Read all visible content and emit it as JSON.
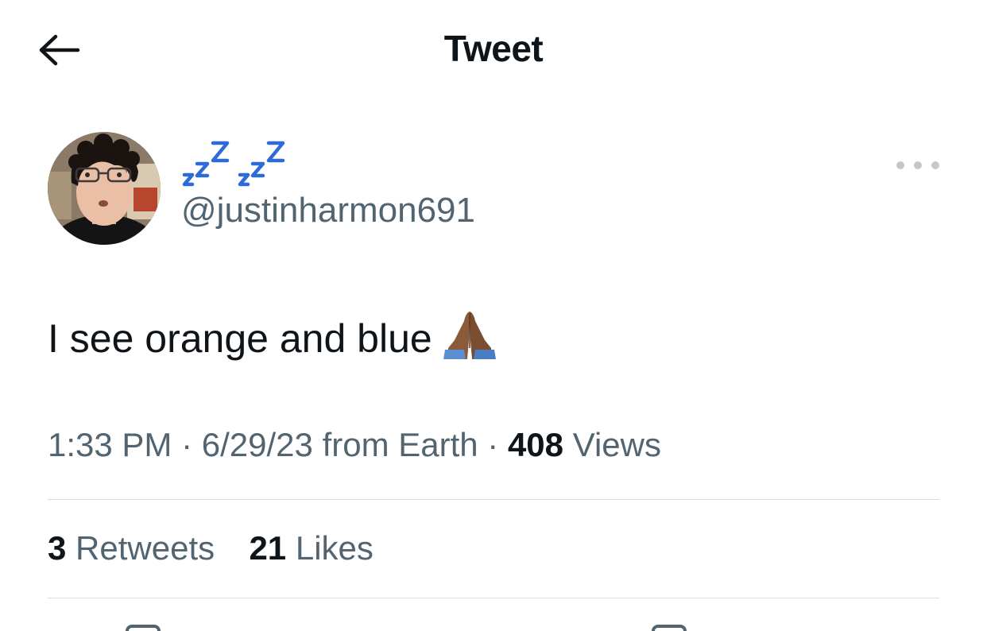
{
  "header": {
    "title": "Tweet",
    "back_icon": "arrow-left-icon"
  },
  "author": {
    "display_name_icon": "zzz-sleeping-emoji",
    "display_name_color": "#2e6bd6",
    "handle": "@justinharmon691",
    "avatar_icon": "profile-photo"
  },
  "tweet": {
    "text": "I see orange and blue",
    "emoji_icon": "folded-hands-emoji"
  },
  "meta": {
    "time": "1:33 PM",
    "date": "6/29/23",
    "source": "from Earth",
    "views_count": "408",
    "views_label": "Views"
  },
  "stats": {
    "retweets_count": "3",
    "retweets_label": "Retweets",
    "likes_count": "21",
    "likes_label": "Likes"
  },
  "colors": {
    "text_primary": "#0f1419",
    "text_secondary": "#536471",
    "divider": "#d9dee2"
  }
}
